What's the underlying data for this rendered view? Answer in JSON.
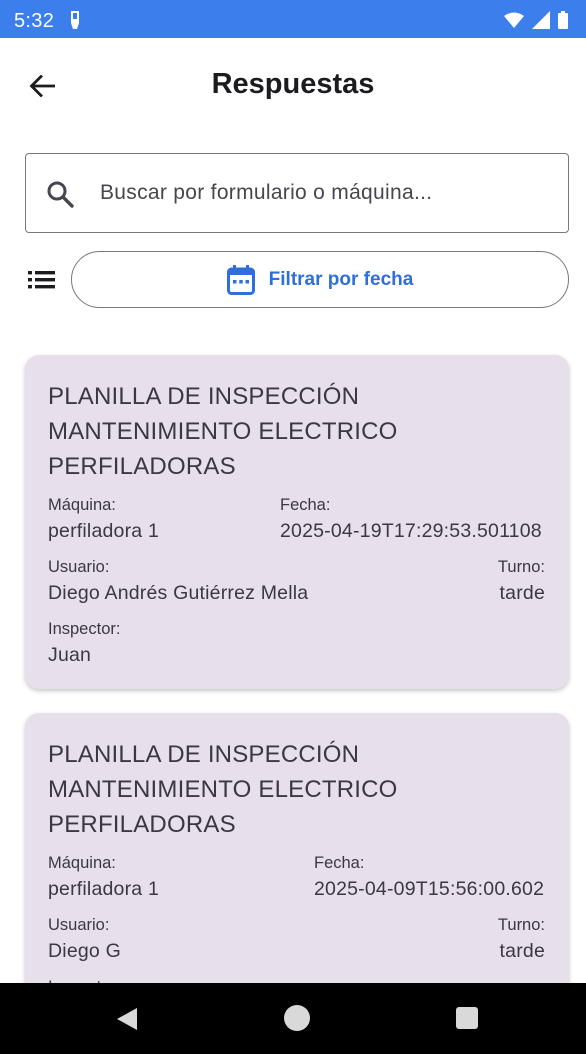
{
  "status_bar": {
    "time": "5:32"
  },
  "app_bar": {
    "title": "Respuestas"
  },
  "search": {
    "placeholder": "Buscar por formulario o máquina..."
  },
  "filter": {
    "label": "Filtrar por fecha"
  },
  "labels": {
    "machine": "Máquina:",
    "date": "Fecha:",
    "user": "Usuario:",
    "shift": "Turno:",
    "inspector": "Inspector:"
  },
  "cards": [
    {
      "title": "PLANILLA DE INSPECCIÓN MANTENIMIENTO ELECTRICO PERFILADORAS",
      "machine": "perfiladora 1",
      "date": "2025-04-19T17:29:53.501108",
      "user": "Diego Andrés Gutiérrez Mella",
      "shift": "tarde",
      "inspector": "Juan"
    },
    {
      "title": "PLANILLA DE INSPECCIÓN MANTENIMIENTO ELECTRICO PERFILADORAS",
      "machine": "perfiladora 1",
      "date": "2025-04-09T15:56:00.602",
      "user": "Diego G",
      "shift": "tarde",
      "inspector": "Inspector:"
    }
  ],
  "colors": {
    "status_bar": "#3d7eed",
    "accent": "#2f6fd9",
    "card_bg": "#e7dfea"
  }
}
